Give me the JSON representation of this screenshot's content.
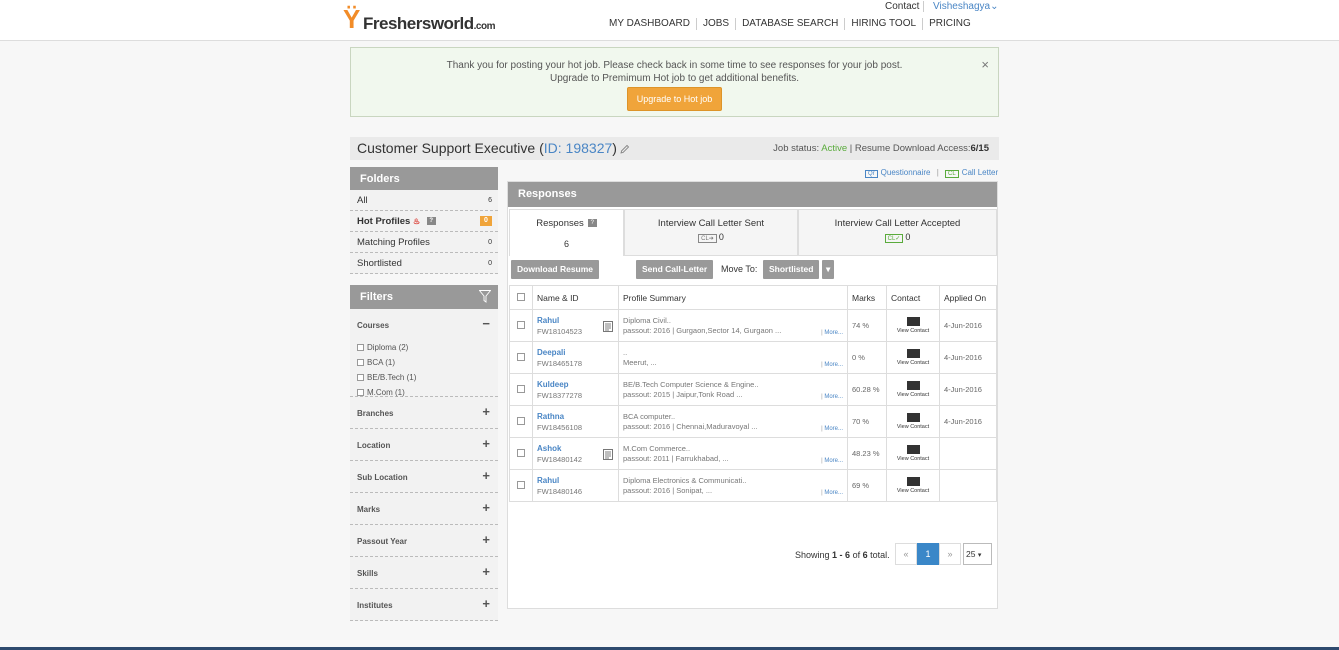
{
  "brand": {
    "logo_text": "Freshersworld",
    "logo_suffix": ".com"
  },
  "top": {
    "contact": "Contact",
    "user": "Visheshagya"
  },
  "nav": [
    "MY DASHBOARD",
    "JOBS",
    "DATABASE SEARCH",
    "HIRING TOOL",
    "PRICING"
  ],
  "alert": {
    "line1": "Thank you for posting your hot job. Please check back in some time to see responses for your job post.",
    "line2": "Upgrade to Premimum Hot job to get additional benefits.",
    "button": "Upgrade to Hot job",
    "close": "×"
  },
  "job": {
    "title": "Customer Support Executive",
    "id_label": "ID: 198327",
    "status_label": "Job status:",
    "status": "Active",
    "access_label": "Resume Download Access:",
    "access_value": "6/15"
  },
  "folders": {
    "heading": "Folders",
    "items": [
      {
        "label": "All",
        "count": "6"
      },
      {
        "label": "Hot Profiles",
        "count": "0"
      },
      {
        "label": "Matching Profiles",
        "count": "0"
      },
      {
        "label": "Shortlisted",
        "count": "0"
      }
    ]
  },
  "filters": {
    "heading": "Filters",
    "courses": {
      "label": "Courses",
      "toggle": "−",
      "options": [
        "Diploma (2)",
        "BCA (1)",
        "BE/B.Tech (1)",
        "M.Com (1)"
      ]
    },
    "sections": [
      "Branches",
      "Location",
      "Sub Location",
      "Marks",
      "Passout Year",
      "Skills",
      "Institutes"
    ],
    "expand": "+"
  },
  "links": {
    "q_tag": "Qr",
    "questionnaire": "Questionnaire",
    "cl_tag": "CL",
    "call_letter": "Call Letter"
  },
  "responses": {
    "heading": "Responses",
    "tabs": [
      {
        "label": "Responses",
        "value": "6",
        "help": "?"
      },
      {
        "label": "Interview Call Letter Sent",
        "tag": "CL➜",
        "value": "0"
      },
      {
        "label": "Interview Call Letter Accepted",
        "tag": "CL✓",
        "value": "0"
      }
    ],
    "toolbar": {
      "download": "Download Resume",
      "send": "Send Call-Letter",
      "move_to": "Move To:",
      "move_value": "Shortlisted",
      "caret": "▾"
    },
    "columns": [
      "Name & ID",
      "Profile Summary",
      "Marks",
      "Contact",
      "Applied On"
    ],
    "view_contact": "View Contact",
    "more": "More...",
    "rows": [
      {
        "name": "Rahul",
        "id": "FW18104523",
        "doc": true,
        "s1": "Diploma Civil..",
        "s2": "passout: 2016 | Gurgaon,Sector 14, Gurgaon ...",
        "marks": "74 %",
        "date": "4-Jun-2016"
      },
      {
        "name": "Deepali",
        "id": "FW18465178",
        "doc": false,
        "s1": "..",
        "s2": "Meerut, ...",
        "marks": "0 %",
        "date": "4-Jun-2016"
      },
      {
        "name": "Kuldeep",
        "id": "FW18377278",
        "doc": false,
        "s1": "BE/B.Tech Computer Science & Engine..",
        "s2": "passout: 2015 | Jaipur,Tonk Road ...",
        "marks": "60.28 %",
        "date": "4-Jun-2016"
      },
      {
        "name": "Rathna",
        "id": "FW18456108",
        "doc": false,
        "s1": "BCA computer..",
        "s2": "passout: 2016 | Chennai,Maduravoyal ...",
        "marks": "70 %",
        "date": "4-Jun-2016"
      },
      {
        "name": "Ashok",
        "id": "FW18480142",
        "doc": true,
        "s1": "M.Com Commerce..",
        "s2": "passout: 2011 | Farrukhabad, ...",
        "marks": "48.23 %",
        "date": ""
      },
      {
        "name": "Rahul",
        "id": "FW18480146",
        "doc": false,
        "s1": "Diploma Electronics & Communicati..",
        "s2": "passout: 2016 | Sonipat, ...",
        "marks": "69 %",
        "date": ""
      }
    ],
    "pager": {
      "showing": "Showing",
      "range": "1 - 6",
      "of": "of",
      "total": "6",
      "total_suffix": "total.",
      "prev": "«",
      "page": "1",
      "next": "»",
      "per_page": "25",
      "caret": "▾"
    }
  }
}
